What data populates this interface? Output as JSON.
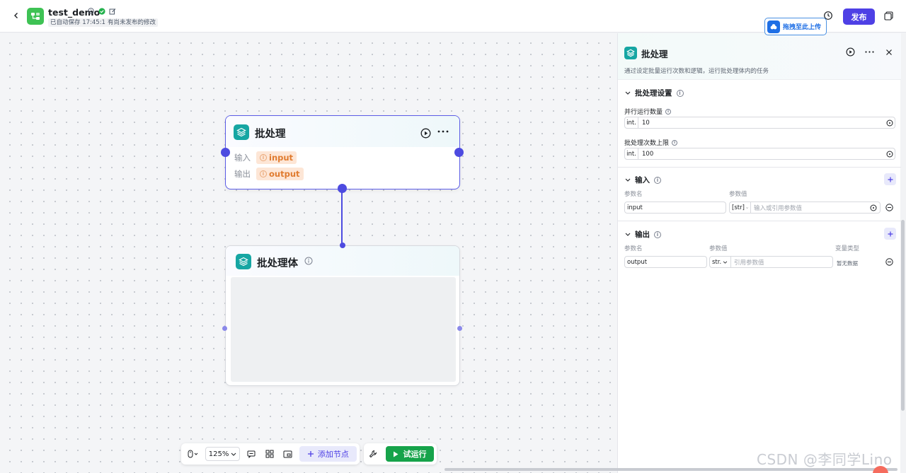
{
  "header": {
    "title": "test_demo",
    "autosave": "已自动保存 17:45:19",
    "unpublished": "有尚未发布的修改",
    "publish_label": "发布",
    "upload_chip_label": "拖拽至此上传"
  },
  "canvas": {
    "batch_node": {
      "title": "批处理",
      "input_label": "输入",
      "input_value": "input",
      "output_label": "输出",
      "output_value": "output"
    },
    "body_node": {
      "title": "批处理体"
    }
  },
  "toolbar": {
    "zoom": "125%",
    "add_node_label": "添加节点",
    "test_run_label": "试运行"
  },
  "panel": {
    "title": "批处理",
    "description": "通过设定批量运行次数和逻辑，运行批处理体内的任务",
    "settings": {
      "heading": "批处理设置",
      "concurrency_label": "并行运行数量",
      "concurrency_type": "int.",
      "concurrency_value": "10",
      "limit_label": "批处理次数上限",
      "limit_type": "int.",
      "limit_value": "100"
    },
    "input": {
      "heading": "输入",
      "col_name": "参数名",
      "col_value": "参数值",
      "param_name": "input",
      "param_type": "[str]",
      "value_placeholder": "输入或引用参数值"
    },
    "output": {
      "heading": "输出",
      "col_name": "参数名",
      "col_value": "参数值",
      "col_type": "变量类型",
      "param_name": "output",
      "param_type": "str.",
      "value_placeholder": "引用参数值",
      "type_value": "暂无数据"
    }
  },
  "watermark": "CSDN @李同学Lino",
  "colors": {
    "primary": "#4e40e5",
    "node_teal": "#16a6a3",
    "run_green": "#16a34a",
    "pill_bg": "#fde6d6",
    "pill_text": "#e07b2f"
  }
}
